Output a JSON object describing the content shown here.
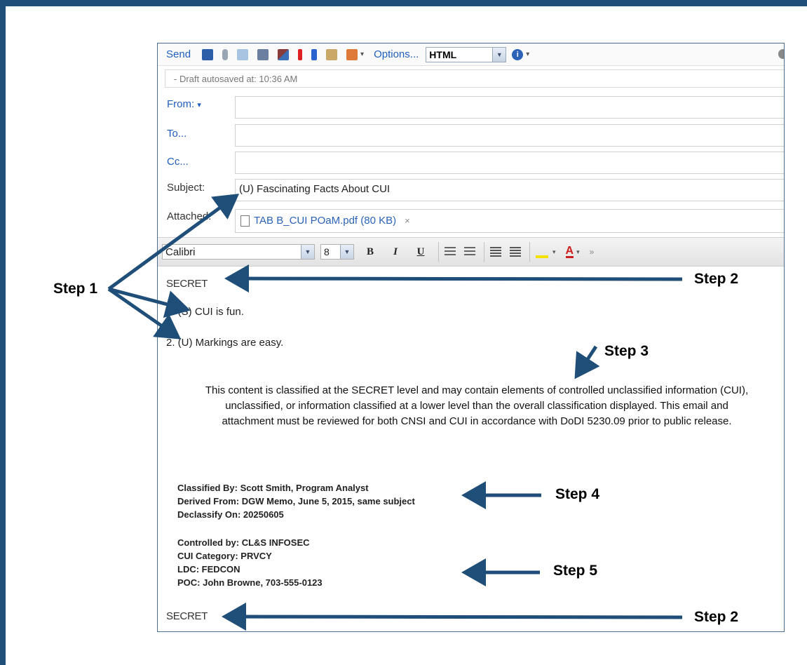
{
  "toolbar": {
    "send_label": "Send",
    "options_label": "Options...",
    "format_value": "HTML",
    "icons": [
      "save-icon",
      "attach-icon",
      "image-icon",
      "address-book-icon",
      "spellcheck-icon",
      "importance-high-icon",
      "importance-low-icon",
      "signature-icon",
      "flag-icon",
      "info-icon"
    ]
  },
  "autosave_text": "- Draft autosaved at: 10:36 AM",
  "headers": {
    "from_label": "From:",
    "to_label": "To...",
    "cc_label": "Cc...",
    "subject_label": "Subject:",
    "subject_value": "(U) Fascinating Facts About CUI",
    "attached_label": "Attached:",
    "attachment_name": "TAB B_CUI POaM.pdf (80 KB)",
    "attachment_remove": "×"
  },
  "format_bar": {
    "font_value": "Calibri",
    "size_value": "8",
    "bold": "B",
    "italic": "I",
    "underline": "U",
    "font_color_glyph": "A",
    "more": "»"
  },
  "body": {
    "banner_top": "SECRET",
    "item1": "1.  (S) CUI is fun.",
    "item2": "2.  (U) Markings are easy.",
    "notice": "This content is classified at the SECRET level and may contain elements of controlled unclassified information (CUI), unclassified, or information classified at a lower level than the overall classification displayed. This email and attachment must be reviewed for both CNSI and CUI in accordance with DoDI 5230.09 prior to public release.",
    "classified_by": "Classified By: Scott Smith,  Program  Analyst",
    "derived_from": "Derived From:  DGW Memo, June 5, 2015,    same subject",
    "declassify_on": "Declassify On: 20250605",
    "controlled_by": "Controlled by: CL&S INFOSEC",
    "cui_category": "CUI Category:  PRVCY",
    "ldc": "LDC: FEDCON",
    "poc": "POC: John Browne, 703-555-0123",
    "banner_bottom": "SECRET"
  },
  "annotations": {
    "step1": "Step 1",
    "step2_top": "Step 2",
    "step3": "Step 3",
    "step4": "Step 4",
    "step5": "Step 5",
    "step2_bottom": "Step 2"
  },
  "colors": {
    "frame": "#1f4e79",
    "arrow": "#1f4e79",
    "link": "#1f5fbf"
  }
}
